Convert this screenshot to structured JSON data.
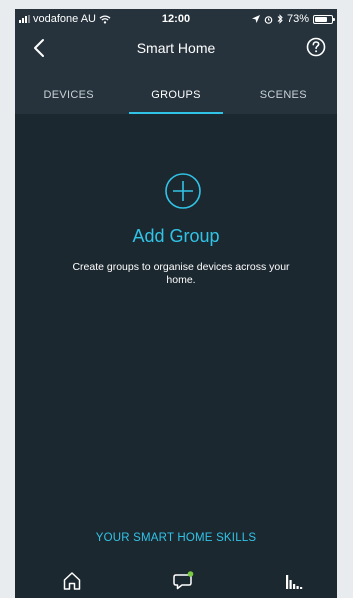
{
  "status_bar": {
    "carrier": "vodafone AU",
    "time": "12:00",
    "battery_percent": "73%",
    "battery_level": 0.73
  },
  "header": {
    "title": "Smart Home",
    "back_icon": "chevron-left-icon",
    "help_icon": "question-circle-icon"
  },
  "tabs": [
    {
      "label": "DEVICES",
      "active": false
    },
    {
      "label": "GROUPS",
      "active": true
    },
    {
      "label": "SCENES",
      "active": false
    }
  ],
  "empty_state": {
    "icon": "plus-circle-icon",
    "title": "Add Group",
    "description": "Create groups to organise devices across your home."
  },
  "skills_link": "YOUR SMART HOME SKILLS",
  "bottom_nav": [
    {
      "name": "home",
      "icon": "home-icon"
    },
    {
      "name": "communicate",
      "icon": "chat-bubble-icon"
    },
    {
      "name": "play",
      "icon": "equalizer-icon"
    }
  ],
  "colors": {
    "background": "#1c2830",
    "header": "#26333d",
    "accent": "#31c3e6",
    "notification_dot": "#7ac943"
  }
}
